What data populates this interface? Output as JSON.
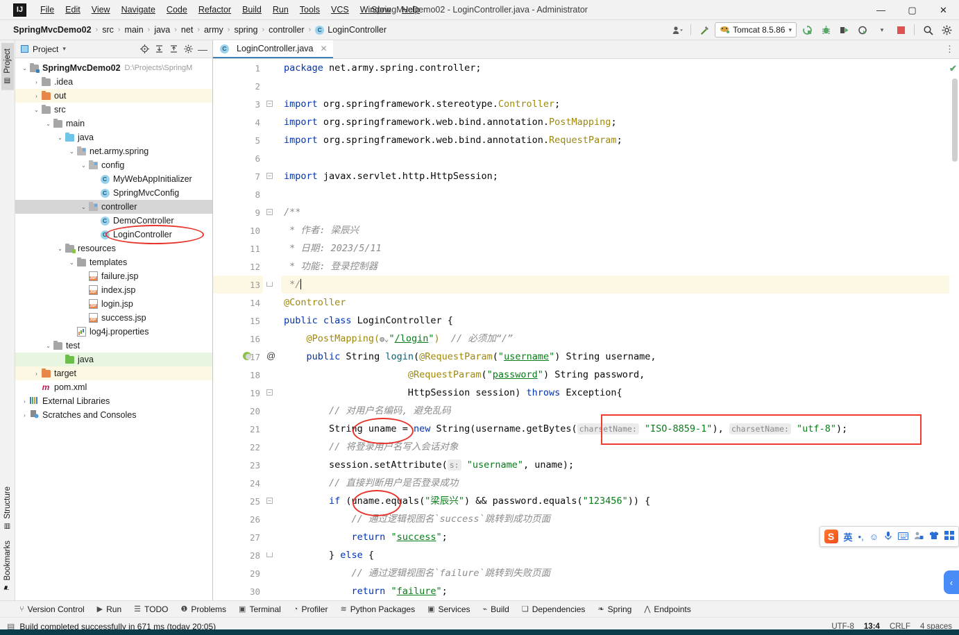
{
  "window": {
    "title": "SpringMvcDemo02 - LoginController.java - Administrator",
    "minimize": "—",
    "maximize": "▢",
    "close": "✕",
    "logo": "IJ"
  },
  "menu": {
    "items": [
      "File",
      "Edit",
      "View",
      "Navigate",
      "Code",
      "Refactor",
      "Build",
      "Run",
      "Tools",
      "VCS",
      "Window",
      "Help"
    ]
  },
  "breadcrumb": {
    "project": "SpringMvcDemo02",
    "parts": [
      "src",
      "main",
      "java",
      "net",
      "army",
      "spring",
      "controller"
    ],
    "file": "LoginController",
    "file_icon_letter": "C",
    "separator": "›"
  },
  "toolbar": {
    "profile_icon": "profile-icon",
    "build_hammer": "build-icon",
    "run_config_name": "Tomcat 8.5.86",
    "run_config_caret": "▾",
    "rerun_label": "rerun-icon",
    "debug_label": "debug-icon",
    "run_with_coverage_label": "coverage-icon",
    "profiler_label": "profiler-icon",
    "stop_label": "stop-icon",
    "search_label": "search-icon",
    "settings_label": "settings-icon",
    "more_label": "⋮"
  },
  "left_tool_strip": {
    "top": [
      {
        "label": "Project",
        "icon": "project-icon",
        "active": true
      }
    ],
    "bottom": [
      {
        "label": "Structure",
        "icon": "structure-icon",
        "active": false
      },
      {
        "label": "Bookmarks",
        "icon": "bookmark-icon",
        "active": false
      }
    ]
  },
  "project_panel": {
    "title": "Project",
    "caret": "▾",
    "actions": [
      "locate-icon",
      "expand-all-icon",
      "collapse-all-icon",
      "gear-icon",
      "hide-icon"
    ],
    "tree": [
      {
        "depth": 0,
        "arrow": "v",
        "icon": "module-folder",
        "label": "SpringMvcDemo02",
        "bold": true,
        "sub": "D:\\Projects\\SpringM",
        "state": ""
      },
      {
        "depth": 1,
        "arrow": ">",
        "icon": "folder-gray",
        "label": ".idea",
        "bold": false,
        "sub": "",
        "state": ""
      },
      {
        "depth": 1,
        "arrow": ">",
        "icon": "folder-orange",
        "label": "out",
        "bold": false,
        "sub": "",
        "state": "yellow"
      },
      {
        "depth": 1,
        "arrow": "v",
        "icon": "folder-gray",
        "label": "src",
        "bold": false,
        "sub": "",
        "state": ""
      },
      {
        "depth": 2,
        "arrow": "v",
        "icon": "folder-gray",
        "label": "main",
        "bold": false,
        "sub": "",
        "state": ""
      },
      {
        "depth": 3,
        "arrow": "v",
        "icon": "folder-blue",
        "label": "java",
        "bold": false,
        "sub": "",
        "state": ""
      },
      {
        "depth": 4,
        "arrow": "v",
        "icon": "package",
        "label": "net.army.spring",
        "bold": false,
        "sub": "",
        "state": ""
      },
      {
        "depth": 5,
        "arrow": "v",
        "icon": "package",
        "label": "config",
        "bold": false,
        "sub": "",
        "state": ""
      },
      {
        "depth": 6,
        "arrow": "",
        "icon": "class",
        "label": "MyWebAppInitializer",
        "bold": false,
        "sub": "",
        "state": ""
      },
      {
        "depth": 6,
        "arrow": "",
        "icon": "class",
        "label": "SpringMvcConfig",
        "bold": false,
        "sub": "",
        "state": ""
      },
      {
        "depth": 5,
        "arrow": "v",
        "icon": "package",
        "label": "controller",
        "bold": false,
        "sub": "",
        "state": "sel"
      },
      {
        "depth": 6,
        "arrow": "",
        "icon": "class",
        "label": "DemoController",
        "bold": false,
        "sub": "",
        "state": ""
      },
      {
        "depth": 6,
        "arrow": "",
        "icon": "class",
        "label": "LoginController",
        "bold": false,
        "sub": "",
        "state": ""
      },
      {
        "depth": 3,
        "arrow": "v",
        "icon": "folder-res",
        "label": "resources",
        "bold": false,
        "sub": "",
        "state": ""
      },
      {
        "depth": 4,
        "arrow": "v",
        "icon": "folder-gray",
        "label": "templates",
        "bold": false,
        "sub": "",
        "state": ""
      },
      {
        "depth": 5,
        "arrow": "",
        "icon": "jsp",
        "label": "failure.jsp",
        "bold": false,
        "sub": "",
        "state": ""
      },
      {
        "depth": 5,
        "arrow": "",
        "icon": "jsp",
        "label": "index.jsp",
        "bold": false,
        "sub": "",
        "state": ""
      },
      {
        "depth": 5,
        "arrow": "",
        "icon": "jsp",
        "label": "login.jsp",
        "bold": false,
        "sub": "",
        "state": ""
      },
      {
        "depth": 5,
        "arrow": "",
        "icon": "jsp",
        "label": "success.jsp",
        "bold": false,
        "sub": "",
        "state": ""
      },
      {
        "depth": 4,
        "arrow": "",
        "icon": "properties",
        "label": "log4j.properties",
        "bold": false,
        "sub": "",
        "state": ""
      },
      {
        "depth": 2,
        "arrow": "v",
        "icon": "folder-gray",
        "label": "test",
        "bold": false,
        "sub": "",
        "state": ""
      },
      {
        "depth": 3,
        "arrow": "",
        "icon": "folder-green",
        "label": "java",
        "bold": false,
        "sub": "",
        "state": "green"
      },
      {
        "depth": 1,
        "arrow": ">",
        "icon": "folder-orange",
        "label": "target",
        "bold": false,
        "sub": "",
        "state": "yellow"
      },
      {
        "depth": 1,
        "arrow": "",
        "icon": "maven",
        "label": "pom.xml",
        "bold": false,
        "sub": "",
        "state": ""
      },
      {
        "depth": 0,
        "arrow": ">",
        "icon": "libraries",
        "label": "External Libraries",
        "bold": false,
        "sub": "",
        "state": ""
      },
      {
        "depth": 0,
        "arrow": ">",
        "icon": "scratches",
        "label": "Scratches and Consoles",
        "bold": false,
        "sub": "",
        "state": ""
      }
    ]
  },
  "editor": {
    "tab": {
      "label": "LoginController.java",
      "icon_letter": "C",
      "close": "✕"
    },
    "more_icon": "⋮",
    "inspection_status": "✔",
    "lines": [
      {
        "n": 1,
        "tokens": [
          {
            "t": "kw",
            "v": "package"
          },
          {
            "t": "p",
            "v": " net.army.spring.controller;"
          }
        ]
      },
      {
        "n": 2,
        "tokens": []
      },
      {
        "n": 3,
        "fold": "open",
        "tokens": [
          {
            "t": "kw",
            "v": "import"
          },
          {
            "t": "p",
            "v": " org.springframework.stereotype."
          },
          {
            "t": "cls",
            "v": "Controller"
          },
          {
            "t": "p",
            "v": ";"
          }
        ]
      },
      {
        "n": 4,
        "tokens": [
          {
            "t": "kw",
            "v": "import"
          },
          {
            "t": "p",
            "v": " org.springframework.web.bind.annotation."
          },
          {
            "t": "cls",
            "v": "PostMapping"
          },
          {
            "t": "p",
            "v": ";"
          }
        ]
      },
      {
        "n": 5,
        "tokens": [
          {
            "t": "kw",
            "v": "import"
          },
          {
            "t": "p",
            "v": " org.springframework.web.bind.annotation."
          },
          {
            "t": "cls",
            "v": "RequestParam"
          },
          {
            "t": "p",
            "v": ";"
          }
        ]
      },
      {
        "n": 6,
        "tokens": []
      },
      {
        "n": 7,
        "fold": "open",
        "tokens": [
          {
            "t": "kw",
            "v": "import"
          },
          {
            "t": "p",
            "v": " javax.servlet.http.HttpSession;"
          }
        ]
      },
      {
        "n": 8,
        "tokens": []
      },
      {
        "n": 9,
        "fold": "open",
        "tokens": [
          {
            "t": "cmt",
            "v": "/**"
          }
        ]
      },
      {
        "n": 10,
        "tokens": [
          {
            "t": "cmt",
            "v": " * 作者: 梁辰兴"
          }
        ]
      },
      {
        "n": 11,
        "tokens": [
          {
            "t": "cmt",
            "v": " * 日期: 2023/5/11"
          }
        ]
      },
      {
        "n": 12,
        "tokens": [
          {
            "t": "cmt",
            "v": " * 功能: 登录控制器"
          }
        ]
      },
      {
        "n": 13,
        "hl": true,
        "fold": "end",
        "tokens": [
          {
            "t": "cmt",
            "v": " */"
          },
          {
            "t": "caret",
            "v": ""
          }
        ]
      },
      {
        "n": 14,
        "tokens": [
          {
            "t": "ann",
            "v": "@Controller"
          }
        ]
      },
      {
        "n": 15,
        "tokens": [
          {
            "t": "kw",
            "v": "public class"
          },
          {
            "t": "p",
            "v": " LoginController {"
          }
        ]
      },
      {
        "n": 16,
        "tokens": [
          {
            "t": "p",
            "v": "    "
          },
          {
            "t": "ann",
            "v": "@PostMapping("
          },
          {
            "t": "globe",
            "v": "◍⌄"
          },
          {
            "t": "str",
            "v": "\""
          },
          {
            "t": "lnk",
            "v": "/login"
          },
          {
            "t": "str",
            "v": "\""
          },
          {
            "t": "ann",
            "v": ")"
          },
          {
            "t": "p",
            "v": "  "
          },
          {
            "t": "cmt",
            "v": "// 必须加“/”"
          }
        ]
      },
      {
        "n": 17,
        "gmark": "@",
        "runmark": true,
        "tokens": [
          {
            "t": "p",
            "v": "    "
          },
          {
            "t": "kw",
            "v": "public"
          },
          {
            "t": "p",
            "v": " String "
          },
          {
            "t": "mth",
            "v": "login"
          },
          {
            "t": "p",
            "v": "("
          },
          {
            "t": "ann",
            "v": "@RequestParam"
          },
          {
            "t": "p",
            "v": "("
          },
          {
            "t": "str",
            "v": "\""
          },
          {
            "t": "lnk",
            "v": "username"
          },
          {
            "t": "str",
            "v": "\""
          },
          {
            "t": "p",
            "v": ") String username,"
          }
        ]
      },
      {
        "n": 18,
        "tokens": [
          {
            "t": "p",
            "v": "                      "
          },
          {
            "t": "ann",
            "v": "@RequestParam"
          },
          {
            "t": "p",
            "v": "("
          },
          {
            "t": "str",
            "v": "\""
          },
          {
            "t": "lnk",
            "v": "password"
          },
          {
            "t": "str",
            "v": "\""
          },
          {
            "t": "p",
            "v": ") String password,"
          }
        ]
      },
      {
        "n": 19,
        "fold": "open",
        "tokens": [
          {
            "t": "p",
            "v": "                      HttpSession session) "
          },
          {
            "t": "kw",
            "v": "throws"
          },
          {
            "t": "p",
            "v": " Exception{"
          }
        ]
      },
      {
        "n": 20,
        "tokens": [
          {
            "t": "p",
            "v": "        "
          },
          {
            "t": "cmt",
            "v": "// 对用户名编码, 避免乱码"
          }
        ]
      },
      {
        "n": 21,
        "tokens": [
          {
            "t": "p",
            "v": "        String uname "
          },
          {
            "t": "p",
            "v": "= "
          },
          {
            "t": "kw",
            "v": "new"
          },
          {
            "t": "p",
            "v": " String(username.getBytes("
          },
          {
            "t": "hint",
            "v": "charsetName:"
          },
          {
            "t": "str",
            "v": " \"ISO-8859-1\""
          },
          {
            "t": "p",
            "v": "), "
          },
          {
            "t": "hint",
            "v": "charsetName:"
          },
          {
            "t": "str",
            "v": " \"utf-8\""
          },
          {
            "t": "p",
            "v": ");"
          }
        ]
      },
      {
        "n": 22,
        "tokens": [
          {
            "t": "p",
            "v": "        "
          },
          {
            "t": "cmt",
            "v": "// 将登录用户名写入会话对象"
          }
        ]
      },
      {
        "n": 23,
        "tokens": [
          {
            "t": "p",
            "v": "        session.setAttribute("
          },
          {
            "t": "hint",
            "v": "s:"
          },
          {
            "t": "str",
            "v": " \"username\""
          },
          {
            "t": "p",
            "v": ", uname);"
          }
        ]
      },
      {
        "n": 24,
        "tokens": [
          {
            "t": "p",
            "v": "        "
          },
          {
            "t": "cmt",
            "v": "// 直接判断用户是否登录成功"
          }
        ]
      },
      {
        "n": 25,
        "fold": "open",
        "tokens": [
          {
            "t": "p",
            "v": "        "
          },
          {
            "t": "kw",
            "v": "if"
          },
          {
            "t": "p",
            "v": " (uname.equals("
          },
          {
            "t": "str",
            "v": "\"梁辰兴\""
          },
          {
            "t": "p",
            "v": ") && password.equals("
          },
          {
            "t": "str",
            "v": "\"123456\""
          },
          {
            "t": "p",
            "v": ")) {"
          }
        ]
      },
      {
        "n": 26,
        "tokens": [
          {
            "t": "p",
            "v": "            "
          },
          {
            "t": "cmt",
            "v": "// 通过逻辑视图名`success`跳转到成功页面"
          }
        ]
      },
      {
        "n": 27,
        "tokens": [
          {
            "t": "p",
            "v": "            "
          },
          {
            "t": "kw",
            "v": "return"
          },
          {
            "t": "p",
            "v": " "
          },
          {
            "t": "str",
            "v": "\""
          },
          {
            "t": "lnk",
            "v": "success"
          },
          {
            "t": "str",
            "v": "\""
          },
          {
            "t": "p",
            "v": ";"
          }
        ]
      },
      {
        "n": 28,
        "fold": "end",
        "tokens": [
          {
            "t": "p",
            "v": "        } "
          },
          {
            "t": "kw",
            "v": "else"
          },
          {
            "t": "p",
            "v": " {"
          }
        ]
      },
      {
        "n": 29,
        "tokens": [
          {
            "t": "p",
            "v": "            "
          },
          {
            "t": "cmt",
            "v": "// 通过逻辑视图名`failure`跳转到失败页面"
          }
        ]
      },
      {
        "n": 30,
        "tokens": [
          {
            "t": "p",
            "v": "            "
          },
          {
            "t": "kw",
            "v": "return"
          },
          {
            "t": "p",
            "v": " "
          },
          {
            "t": "str",
            "v": "\""
          },
          {
            "t": "lnk",
            "v": "failure"
          },
          {
            "t": "str",
            "v": "\""
          },
          {
            "t": "p",
            "v": ";"
          }
        ]
      }
    ]
  },
  "annotations": {
    "color": "#e8332a",
    "box_color": "#f03c2e",
    "items": [
      {
        "name": "login-controller-tree-ellipse",
        "shape": "ellipse"
      },
      {
        "name": "uname-variable-ellipse",
        "shape": "ellipse"
      },
      {
        "name": "uname-equals-ellipse",
        "shape": "ellipse"
      },
      {
        "name": "charset-args-box",
        "shape": "box"
      }
    ]
  },
  "bottom_tool_windows": [
    {
      "label": "Version Control",
      "icon": "branch-icon"
    },
    {
      "label": "Run",
      "icon": "play-icon"
    },
    {
      "label": "TODO",
      "icon": "list-icon"
    },
    {
      "label": "Problems",
      "icon": "warning-icon"
    },
    {
      "label": "Terminal",
      "icon": "terminal-icon"
    },
    {
      "label": "Profiler",
      "icon": "profiler-icon"
    },
    {
      "label": "Python Packages",
      "icon": "packages-icon"
    },
    {
      "label": "Services",
      "icon": "services-icon"
    },
    {
      "label": "Build",
      "icon": "hammer-icon"
    },
    {
      "label": "Dependencies",
      "icon": "layers-icon"
    },
    {
      "label": "Spring",
      "icon": "leaf-icon"
    },
    {
      "label": "Endpoints",
      "icon": "endpoints-icon"
    }
  ],
  "status_bar": {
    "message": "Build completed successfully in 671 ms (today 20:05)",
    "message_icon": "build-result-icon",
    "encoding": "UTF-8",
    "caret_position": "13:4",
    "line_separator": "CRLF",
    "indent": "4 spaces"
  },
  "ime_toolbar": {
    "logo": "S",
    "mode": "英",
    "items": [
      "voice-punct-icon",
      "emoji-icon",
      "microphone-icon",
      "keyboard-icon",
      "account-icon",
      "skin-icon",
      "apps-icon"
    ]
  },
  "collapse_pill": {
    "icon": "‹"
  }
}
